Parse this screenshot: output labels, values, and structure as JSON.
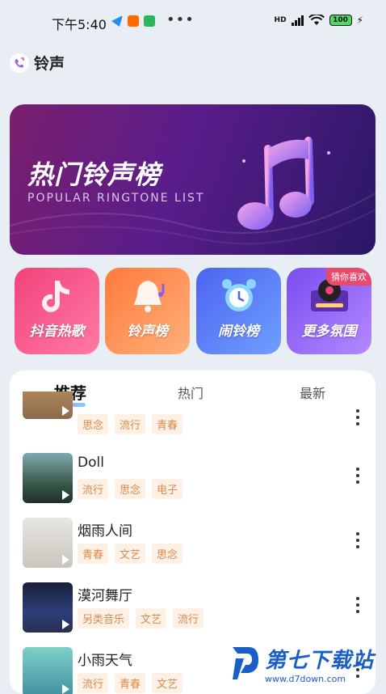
{
  "status_bar": {
    "time": "下午5:40",
    "network": "HD",
    "battery": "100"
  },
  "header": {
    "title": "铃声"
  },
  "banner": {
    "title": "热门铃声榜",
    "subtitle": "POPULAR RINGTONE LIST"
  },
  "tiles": [
    {
      "label": "抖音热歌"
    },
    {
      "label": "铃声榜"
    },
    {
      "label": "闹铃榜"
    },
    {
      "label": "更多氛围",
      "badge": "猜你喜欢"
    }
  ],
  "tabs": [
    {
      "label": "推荐"
    },
    {
      "label": "热门"
    },
    {
      "label": "最新"
    }
  ],
  "songs": [
    {
      "title": "",
      "tags": [
        "思念",
        "流行",
        "青春"
      ]
    },
    {
      "title": "Doll",
      "tags": [
        "流行",
        "思念",
        "电子"
      ]
    },
    {
      "title": "烟雨人间",
      "tags": [
        "青春",
        "文艺",
        "思念"
      ]
    },
    {
      "title": "漠河舞厅",
      "tags": [
        "另类音乐",
        "文艺",
        "流行"
      ]
    },
    {
      "title": "小雨天气",
      "tags": [
        "流行",
        "青春",
        "文艺"
      ]
    }
  ],
  "watermark": {
    "name": "第七下载站",
    "url": "www.d7down.com"
  }
}
